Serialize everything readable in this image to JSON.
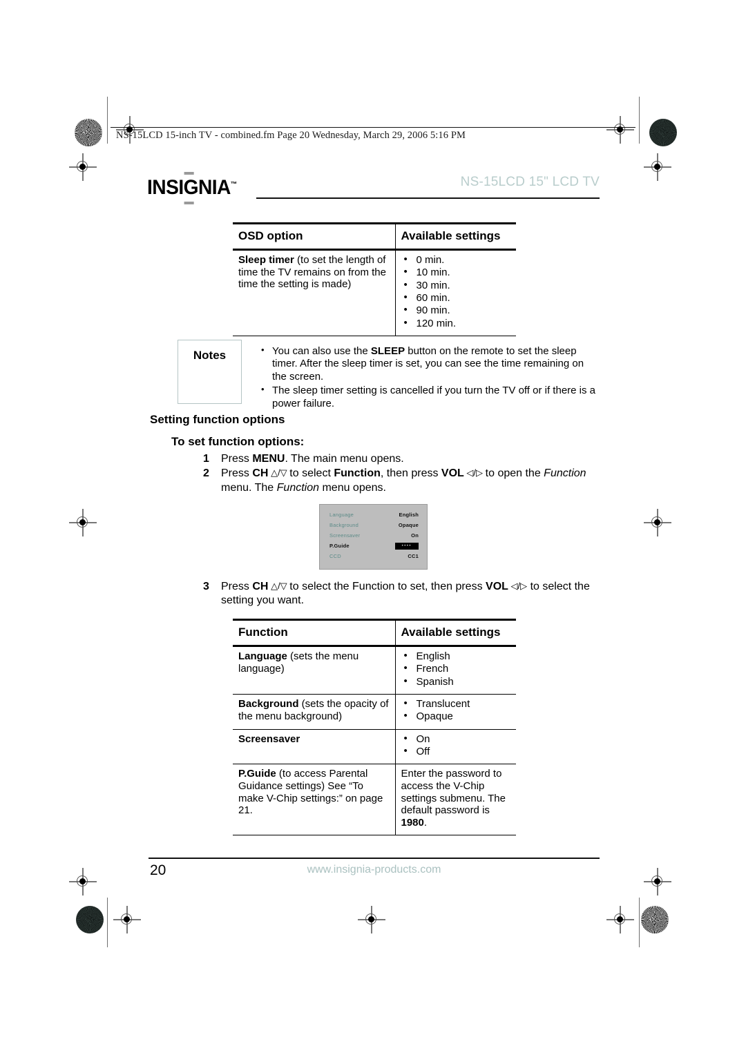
{
  "file_header": "NS-15LCD 15-inch TV - combined.fm  Page 20  Wednesday, March 29, 2006  5:16 PM",
  "brand": {
    "logo_text_1": "INSI",
    "logo_text_g": "G",
    "logo_text_2": "NIA",
    "logo_tm": "™",
    "product_title": "NS-15LCD 15\" LCD TV",
    "title_color": "#b9cdcc"
  },
  "table_osd": {
    "headers": [
      "OSD option",
      "Available settings"
    ],
    "rows": [
      {
        "option_bold": "Sleep timer",
        "option_rest": " (to set the length of time the TV remains on from the time the setting is made)",
        "settings": [
          "0 min.",
          "10 min.",
          "30 min.",
          "60 min.",
          "90 min.",
          "120 min."
        ]
      }
    ]
  },
  "notes": {
    "label": "Notes",
    "items": [
      {
        "pre": "You can also use the ",
        "bold": "SLEEP",
        "post": " button on the remote to set the sleep timer. After the sleep timer is set, you can see the time remaining on the screen."
      },
      {
        "pre": "The sleep timer setting is cancelled if you turn the TV off or if there is a power failure.",
        "bold": "",
        "post": ""
      }
    ]
  },
  "section": {
    "heading": "Setting function options",
    "subheading": "To set function options:",
    "steps": [
      {
        "num": "1",
        "segments": [
          {
            "t": "Press ",
            "style": "normal"
          },
          {
            "t": "MENU",
            "style": "bold"
          },
          {
            "t": ". The main menu opens.",
            "style": "normal"
          }
        ]
      },
      {
        "num": "2",
        "segments": [
          {
            "t": "Press ",
            "style": "normal"
          },
          {
            "t": "CH",
            "style": "bold"
          },
          {
            "t": " △/▽ ",
            "style": "glyph"
          },
          {
            "t": "to select ",
            "style": "normal"
          },
          {
            "t": "Function",
            "style": "bold"
          },
          {
            "t": ", then press ",
            "style": "normal"
          },
          {
            "t": "VOL",
            "style": "bold"
          },
          {
            "t": " ◁/▷ ",
            "style": "glyph"
          },
          {
            "t": "to open the ",
            "style": "normal"
          },
          {
            "t": "Function",
            "style": "italic"
          },
          {
            "t": " menu. The ",
            "style": "normal"
          },
          {
            "t": "Function",
            "style": "italic"
          },
          {
            "t": " menu opens.",
            "style": "normal"
          }
        ]
      },
      {
        "num": "3",
        "segments": [
          {
            "t": "Press ",
            "style": "normal"
          },
          {
            "t": "CH",
            "style": "bold"
          },
          {
            "t": " △/▽ ",
            "style": "glyph"
          },
          {
            "t": "to select the Function to set, then press ",
            "style": "normal"
          },
          {
            "t": "VOL",
            "style": "bold"
          },
          {
            "t": " ◁/▷",
            "style": "glyph"
          },
          {
            "t": " to select the setting you want.",
            "style": "normal"
          }
        ]
      }
    ]
  },
  "osd_screen": {
    "rows": [
      {
        "label": "Language",
        "value": "English",
        "selected": false,
        "password_box": false
      },
      {
        "label": "Background",
        "value": "Opaque",
        "selected": false,
        "password_box": false
      },
      {
        "label": "Screensaver",
        "value": "On",
        "selected": false,
        "password_box": false
      },
      {
        "label": "P.Guide",
        "value": "••••",
        "selected": true,
        "password_box": true
      },
      {
        "label": "CCD",
        "value": "CC1",
        "selected": false,
        "password_box": false
      }
    ],
    "label_color": "#5d8b88",
    "background_color": "#bdbdbd"
  },
  "table_function": {
    "headers": [
      "Function",
      "Available settings"
    ],
    "rows": [
      {
        "option_bold": "Language",
        "option_rest": " (sets the menu language)",
        "settings": [
          "English",
          "French",
          "Spanish"
        ],
        "settings_is_text": false
      },
      {
        "option_bold": "Background",
        "option_rest": " (sets the opacity of the menu background)",
        "settings": [
          "Translucent",
          "Opaque"
        ],
        "settings_is_text": false
      },
      {
        "option_bold": "Screensaver",
        "option_rest": "",
        "settings": [
          "On",
          "Off"
        ],
        "settings_is_text": false
      },
      {
        "option_bold": "P.Guide",
        "option_rest": " (to access Parental Guidance settings) See “To make V-Chip settings:” on page 21.",
        "settings_text_pre": "Enter the password to access the V-Chip settings submenu. The default password is ",
        "settings_text_bold": "1980",
        "settings_text_post": ".",
        "settings_is_text": true
      }
    ]
  },
  "footer": {
    "page_number": "20",
    "url": "www.insignia-products.com",
    "url_color": "#aac1c0"
  }
}
